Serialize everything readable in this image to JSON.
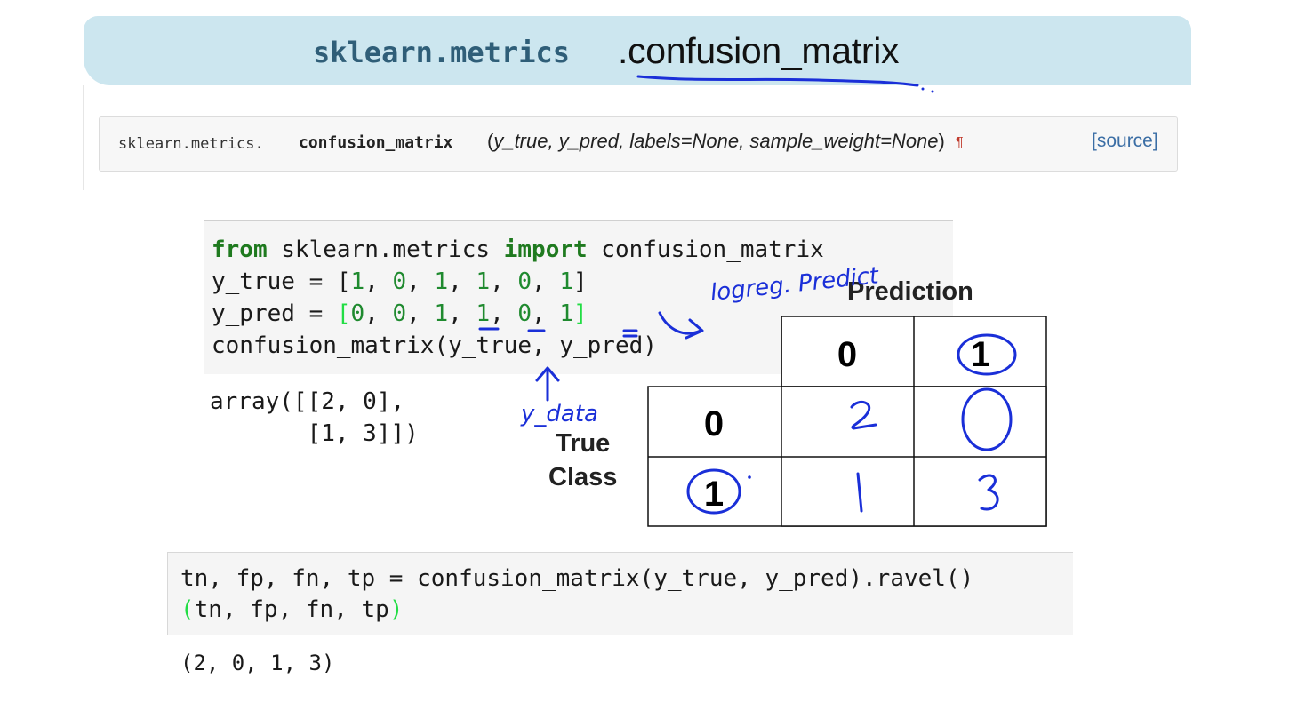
{
  "title": {
    "prefix": "sklearn.metrics",
    "name": ".confusion_matrix"
  },
  "signature": {
    "prefix": "sklearn.metrics.",
    "function": "confusion_matrix",
    "open_paren": "(",
    "params": "y_true, y_pred, labels=None, sample_weight=None",
    "close_paren": ")",
    "pilcrow": "¶",
    "source_link": "[source]"
  },
  "code_cell_1": {
    "line1": {
      "kw_from": "from",
      "module": " sklearn.metrics ",
      "kw_import": "import",
      "name": " confusion_matrix"
    },
    "line2": {
      "lhs": "y_true = [",
      "values": [
        "1",
        "0",
        "1",
        "1",
        "0",
        "1"
      ],
      "rhs": "]"
    },
    "line3": {
      "lhs": "y_pred = ",
      "open": "[",
      "values": [
        "0",
        "0",
        "1",
        "1",
        "0",
        "1"
      ],
      "close": "]"
    },
    "line4": "confusion_matrix(y_true, y_pred)",
    "output": [
      "array([[2, 0],",
      "       [1, 3]])"
    ]
  },
  "matrix": {
    "prediction_title": "Prediction",
    "true_class_title": [
      "True",
      "Class"
    ],
    "col_headers": [
      "0",
      "1"
    ],
    "row_headers": [
      "0",
      "1"
    ],
    "cells": [
      [
        "2",
        "0"
      ],
      [
        "1",
        "3"
      ]
    ]
  },
  "code_cell_2": {
    "line1": "tn, fp, fn, tp = confusion_matrix(y_true, y_pred).ravel()",
    "line2_open": "(",
    "line2_body": "tn, fp, fn, tp",
    "line2_close": ")",
    "output": "(2, 0, 1, 3)"
  },
  "annotations": {
    "handwritten_predict": "logreg. Predict",
    "handwritten_ydata": "y_data"
  },
  "colors": {
    "banner": "#cce6ef",
    "keyword": "#1f7a1f",
    "ink": "#1a2fd8",
    "link": "#3b6ea5"
  }
}
